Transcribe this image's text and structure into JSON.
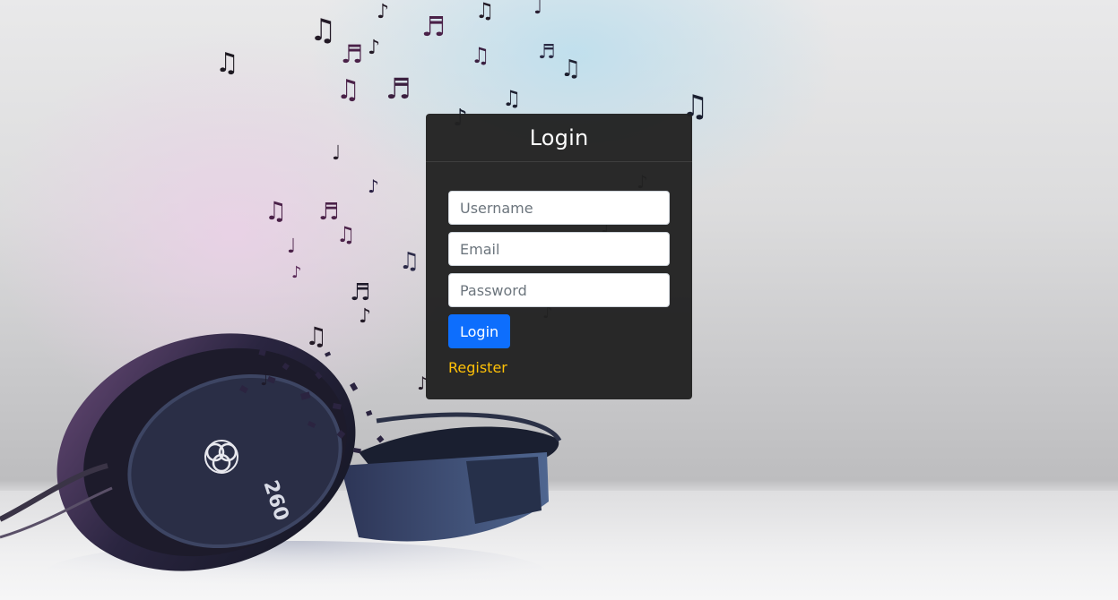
{
  "background": {
    "description_icon": "headphones-music-notes-illustration",
    "colors": {
      "notes_dark": "#2b1a2e",
      "notes_purple": "#6b2f62",
      "headphone_dark": "#1d2235",
      "headphone_blue": "#3a4f7a"
    }
  },
  "login_panel": {
    "title": "Login",
    "username": {
      "placeholder": "Username",
      "value": ""
    },
    "email": {
      "placeholder": "Email",
      "value": ""
    },
    "password": {
      "placeholder": "Password",
      "value": ""
    },
    "submit_label": "Login",
    "register_label": "Register",
    "colors": {
      "panel_bg": "#212121",
      "button_bg": "#0d6efd",
      "link": "#ffc107"
    }
  }
}
